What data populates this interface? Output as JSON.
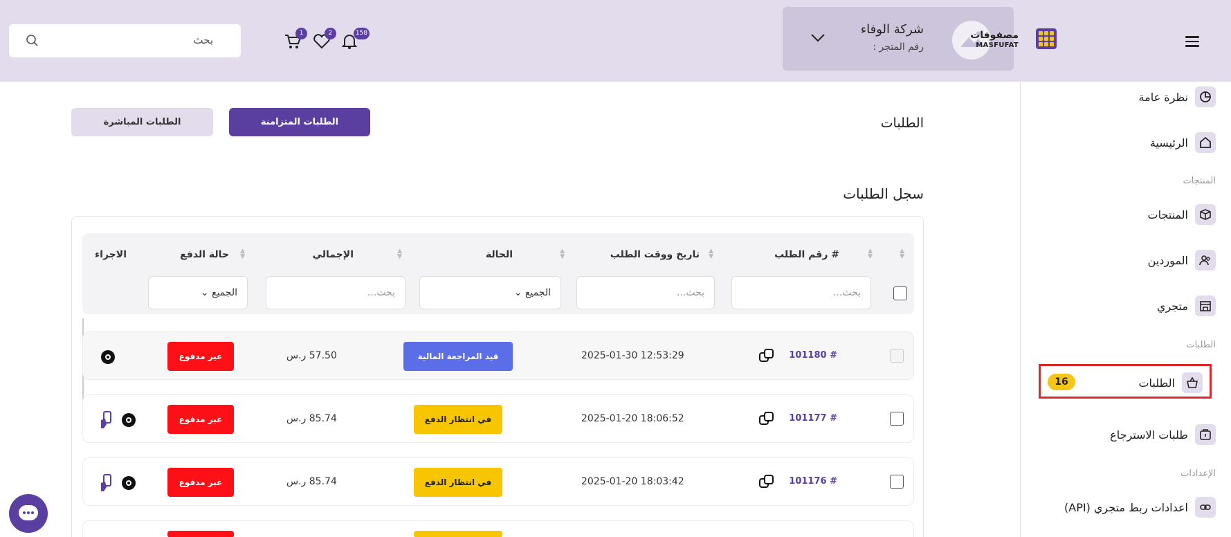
{
  "header": {
    "search_placeholder": "بحث",
    "notifications_count": "158",
    "favorites_count": "2",
    "cart_count": "1",
    "company_name": "شركة الوفاء",
    "store_number_label": "رقم المتجر :",
    "logo_ar": "مصفوفات",
    "logo_en": "MASFUFAT"
  },
  "sidebar": {
    "overview": "نظرة عامة",
    "home": "الرئيسية",
    "section_products": "المنتجات",
    "products": "المنتجات",
    "suppliers": "الموردين",
    "my_store": "متجري",
    "section_orders": "الطلبات",
    "orders": "الطلبات",
    "orders_badge": "16",
    "returns": "طلبات الاسترجاع",
    "section_settings": "الإعدادات",
    "api_settings": "اعدادات ربط متجري (API)"
  },
  "main": {
    "page_title": "الطلبات",
    "tab_sync": "الطلبات المتزامنة",
    "tab_direct": "الطلبات المباشرة",
    "section_title": "سجل الطلبات"
  },
  "table": {
    "columns": {
      "order_no": "# رقم الطلب",
      "datetime": "تاريخ ووقت الطلب",
      "status": "الحالة",
      "total": "الإجمالي",
      "payment": "حالة الدفع",
      "action": "الاجراء"
    },
    "filters": {
      "order_no": "بحث...",
      "datetime": "بحث...",
      "status": "الجميع",
      "total": "بحث...",
      "payment": "الجميع"
    },
    "rows": [
      {
        "order_no": "101180 #",
        "datetime": "2025-01-30 12:53:29",
        "status": "قيد المراجعة المالية",
        "total": "57.50 ر.س",
        "payment": "غير مدفوع"
      },
      {
        "order_no": "101177 #",
        "datetime": "2025-01-20 18:06:52",
        "status": "في انتظار الدفع",
        "total": "85.74 ر.س",
        "payment": "غير مدفوع"
      },
      {
        "order_no": "101176 #",
        "datetime": "2025-01-20 18:03:42",
        "status": "في انتظار الدفع",
        "total": "85.74 ر.س",
        "payment": "غير مدفوع"
      }
    ]
  },
  "colors": {
    "brand_purple": "#5b3fa0",
    "header_bg": "#e2dcec",
    "status_review": "#5b6ee8",
    "status_waiting": "#f7c600",
    "unpaid": "#ff0f16",
    "highlight": "#e0252b"
  }
}
